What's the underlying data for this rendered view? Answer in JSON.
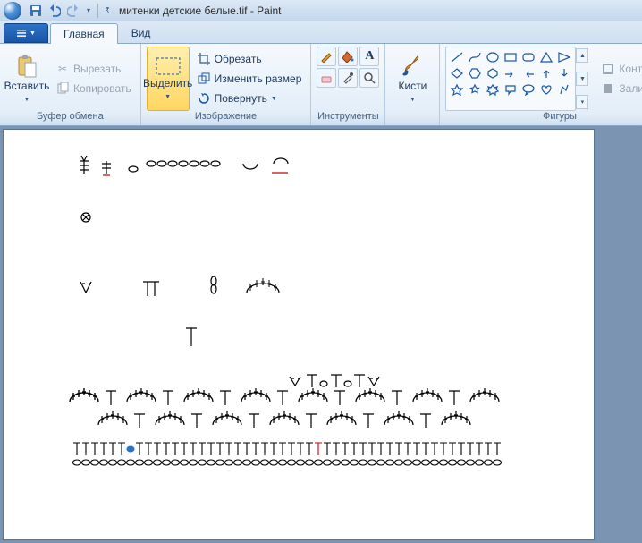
{
  "window": {
    "title": "митенки детские белые.tif - Paint"
  },
  "tabs": {
    "home": "Главная",
    "view": "Вид"
  },
  "clipboard": {
    "paste": "Вставить",
    "cut": "Вырезать",
    "copy": "Копировать",
    "group": "Буфер обмена"
  },
  "image": {
    "select": "Выделить",
    "crop": "Обрезать",
    "resize": "Изменить размер",
    "rotate": "Повернуть",
    "group": "Изображение"
  },
  "tools": {
    "group": "Инструменты",
    "brushes": "Кисти"
  },
  "shapes": {
    "group": "Фигуры",
    "outline": "Контур",
    "fill": "Заливка"
  }
}
